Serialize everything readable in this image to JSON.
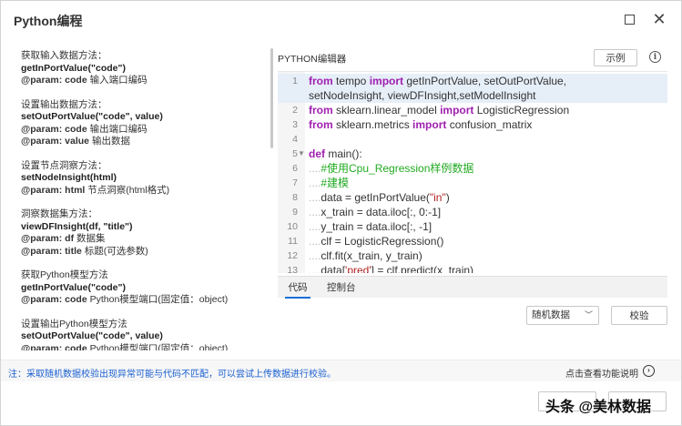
{
  "window": {
    "title": "Python编程"
  },
  "help": {
    "blocks": [
      {
        "desc": "获取输入数据方法：",
        "fn": "getInPortValue(\"code\")",
        "params": [
          {
            "key": "@param: code",
            "text": " 输入端口编码"
          }
        ]
      },
      {
        "desc": "设置输出数据方法：",
        "fn": "setOutPortValue(\"code\", value)",
        "params": [
          {
            "key": "@param: code",
            "text": " 输出端口编码"
          },
          {
            "key": "@param: value",
            "text": " 输出数据"
          }
        ]
      },
      {
        "desc": "设置节点洞察方法：",
        "fn": "setNodeInsight(html)",
        "params": [
          {
            "key": "@param: html",
            "text": " 节点洞察(html格式)"
          }
        ]
      },
      {
        "desc": "洞察数据集方法：",
        "fn": "viewDFInsight(df, \"title\")",
        "params": [
          {
            "key": "@param: df",
            "text": " 数据集"
          },
          {
            "key": "@param: title",
            "text": " 标题(可选参数)"
          }
        ]
      },
      {
        "desc": "获取Python模型方法",
        "fn": "getInPortValue(\"code\")",
        "params": [
          {
            "key": "@param: code",
            "text": " Python模型端口(固定值：object)"
          }
        ]
      },
      {
        "desc": "设置输出Python模型方法",
        "fn": "setOutPortValue(\"code\", value)",
        "params": [
          {
            "key": "@param: code",
            "text": " Python模型端口(固定值：object)"
          }
        ]
      }
    ]
  },
  "editor": {
    "label": "PYTHON编辑器",
    "example_label": "示例",
    "line_numbers": [
      "1",
      "2",
      "3",
      "4",
      "5",
      "6",
      "7",
      "8",
      "9",
      "10",
      "11",
      "12",
      "13"
    ],
    "tabs": {
      "code": "代码",
      "console": "控制台"
    }
  },
  "controls": {
    "data_select": "随机数据",
    "check_label": "校验"
  },
  "footer": {
    "note": "注：采取随机数据校验出现异常可能与代码不匹配，可以尝试上传数据进行校验。",
    "help_link": "点击查看功能说明"
  },
  "watermark": "头条 @美林数据",
  "colors": {
    "keyword": "#a020b0",
    "comment": "#22aa22",
    "string": "#b22222",
    "note": "#1a5fd0",
    "tab_accent": "#1a6fd8"
  }
}
